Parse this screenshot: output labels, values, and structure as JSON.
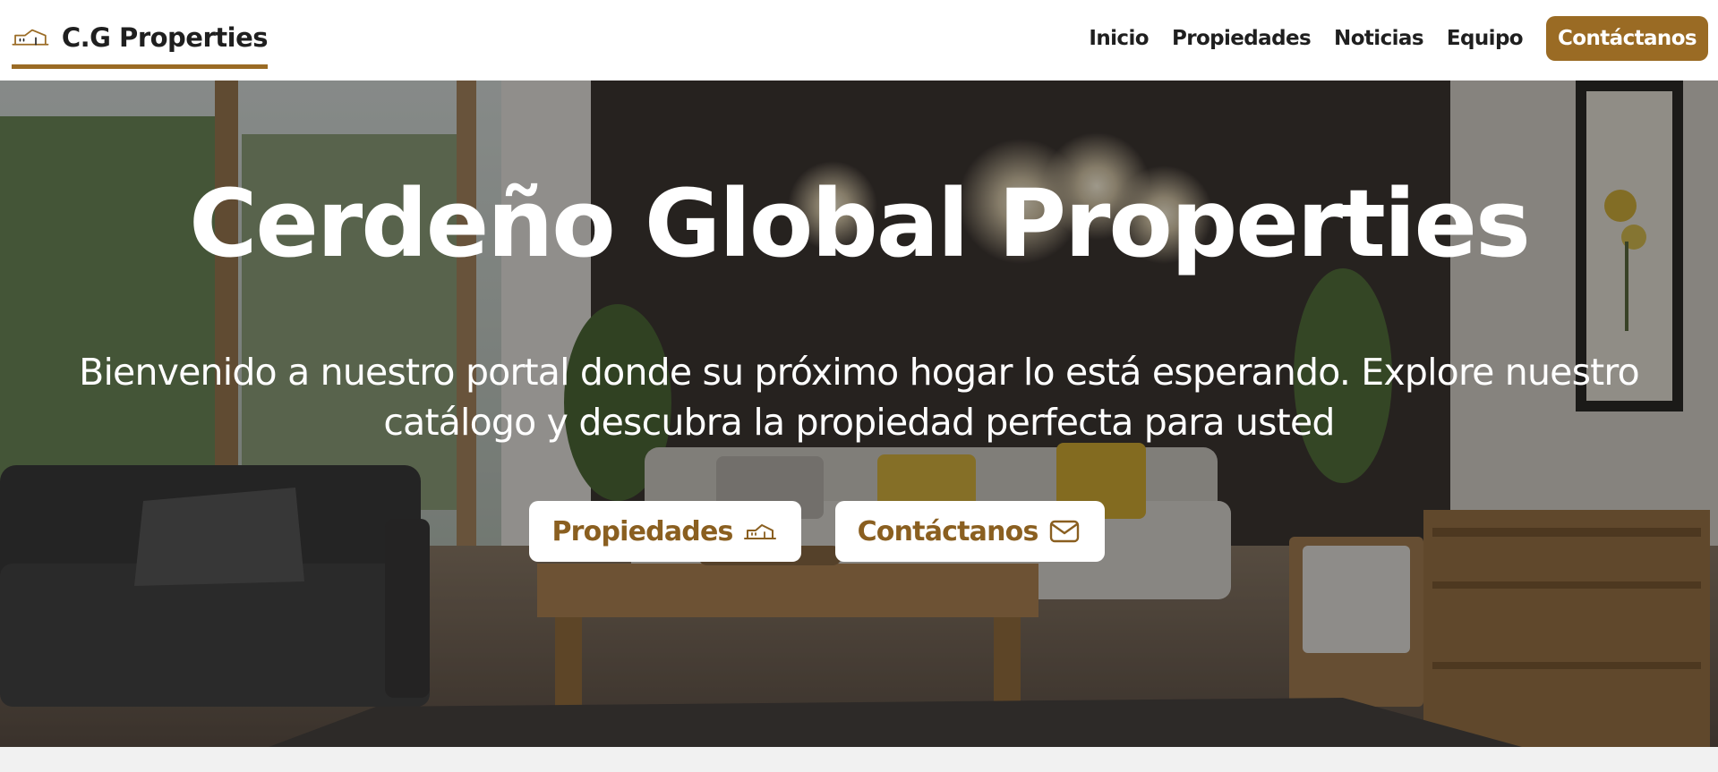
{
  "header": {
    "brand_name": "C.G Properties",
    "brand_icon": "house-outline-icon",
    "nav": [
      {
        "label": "Inicio"
      },
      {
        "label": "Propiedades"
      },
      {
        "label": "Noticias"
      },
      {
        "label": "Equipo"
      }
    ],
    "cta_label": "Contáctanos"
  },
  "hero": {
    "title": "Cerdeño Global Properties",
    "subtitle": "Bienvenido a nuestro portal donde su próximo hogar lo está esperando. Explore nuestro catálogo y descubra la propiedad perfecta para usted",
    "buttons": [
      {
        "label": "Propiedades",
        "icon": "house-outline-icon"
      },
      {
        "label": "Contáctanos",
        "icon": "envelope-icon"
      }
    ]
  },
  "colors": {
    "accent": "#9a6b24",
    "accent_text": "#8a5f20",
    "header_bg": "#ffffff",
    "text_dark": "#1f1f1f"
  }
}
